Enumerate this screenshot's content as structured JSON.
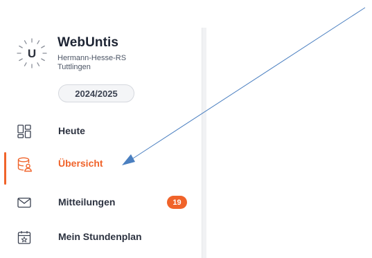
{
  "school": {
    "app_name": "WebUntis",
    "logo_letter": "U",
    "school_name": "Hermann-Hesse-RS",
    "city": "Tuttlingen",
    "school_year": "2024/2025"
  },
  "nav": {
    "items": [
      {
        "label": "Heute",
        "icon": "dashboard-grid-icon",
        "active": false
      },
      {
        "label": "Übersicht",
        "icon": "database-user-icon",
        "active": true
      },
      {
        "label": "Mitteilungen",
        "icon": "envelope-icon",
        "active": false,
        "badge": "19"
      },
      {
        "label": "Mein Stundenplan",
        "icon": "calendar-star-icon",
        "active": false
      }
    ]
  },
  "colors": {
    "accent": "#f0632a",
    "text": "#2c3240",
    "annotation_arrow": "#4a7fc0"
  }
}
